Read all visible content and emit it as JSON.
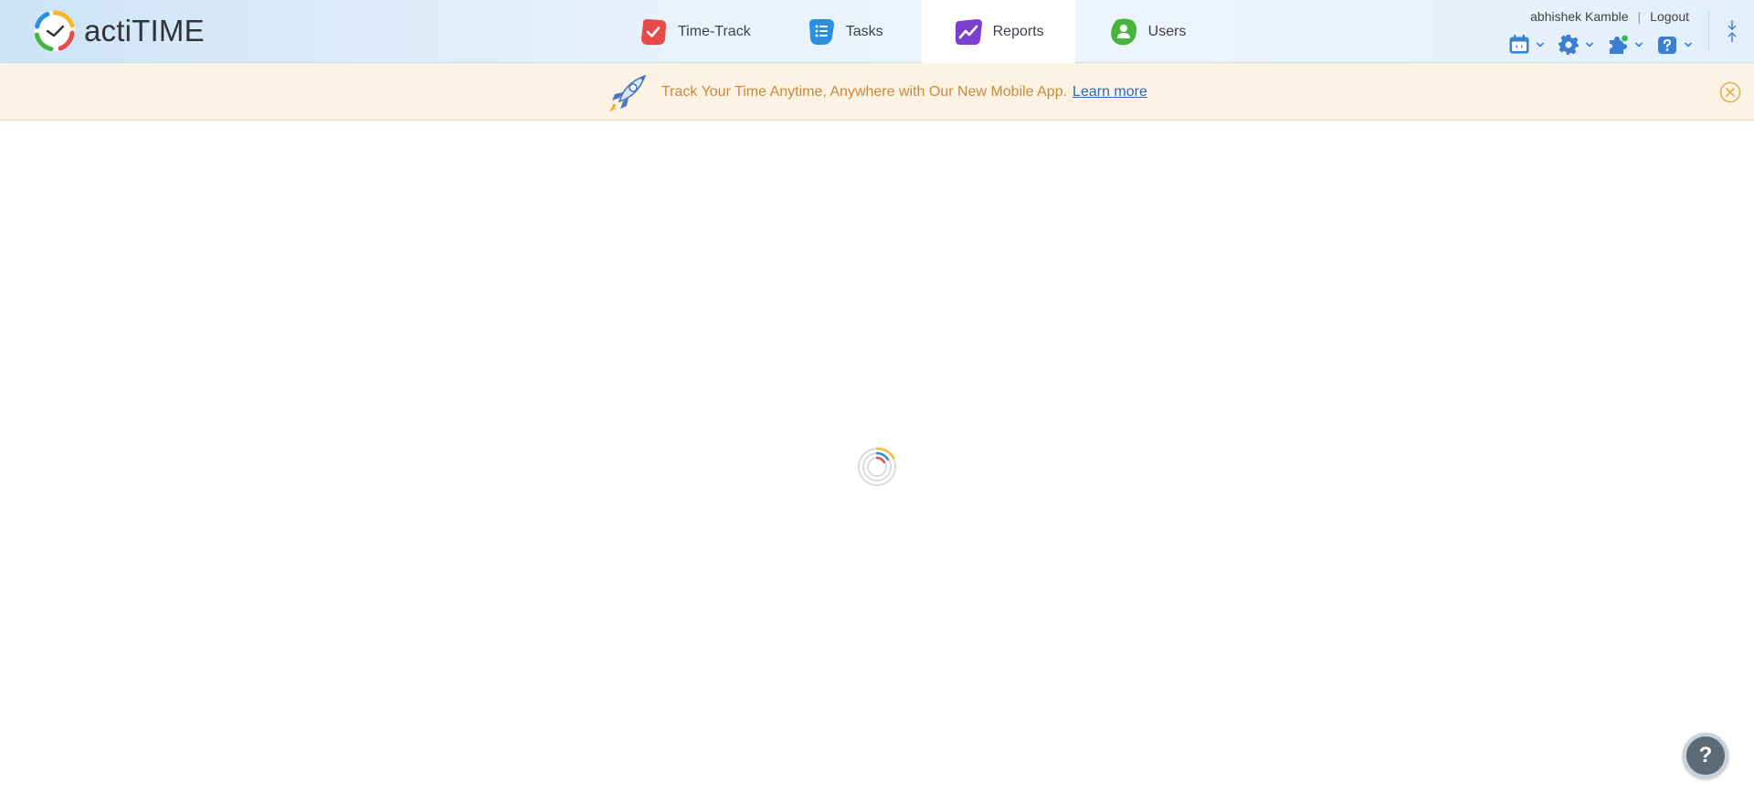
{
  "app": {
    "name": "actiTIME"
  },
  "nav": {
    "items": [
      {
        "label": "Time-Track",
        "icon": "time-track-icon",
        "color": "#e84a4a"
      },
      {
        "label": "Tasks",
        "icon": "tasks-icon",
        "color": "#2b8fe0"
      },
      {
        "label": "Reports",
        "icon": "reports-icon",
        "color": "#7b3fd0",
        "active": true
      },
      {
        "label": "Users",
        "icon": "users-icon",
        "color": "#47b53b"
      }
    ]
  },
  "user": {
    "name": "abhishek Kamble",
    "separator": "|",
    "logout_label": "Logout"
  },
  "tools": [
    {
      "icon": "calendar-icon"
    },
    {
      "icon": "gear-icon"
    },
    {
      "icon": "puzzle-icon"
    },
    {
      "icon": "help-icon"
    }
  ],
  "banner": {
    "text": "Track Your Time Anytime, Anywhere with Our New Mobile App.",
    "link_label": "Learn more",
    "text_color": "#c9893a",
    "background": "#fdf3e4"
  },
  "help_fab": {
    "label": "?"
  },
  "colors": {
    "accent_blue": "#3c7fd0",
    "loader_ring": "#d7dbe0"
  }
}
